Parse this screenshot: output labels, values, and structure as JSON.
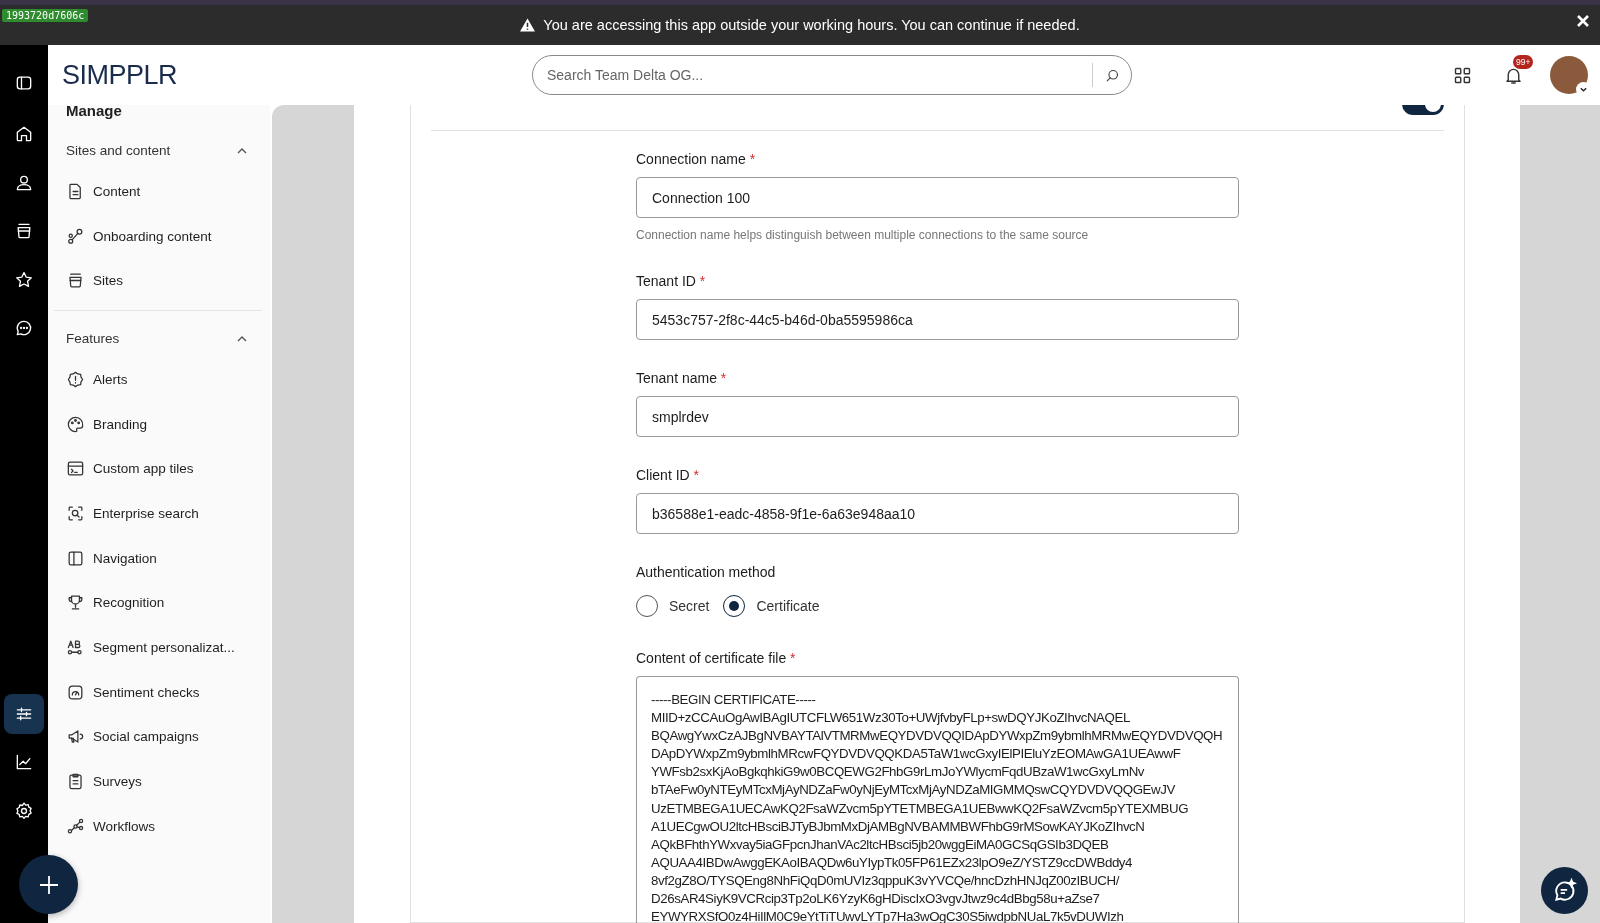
{
  "env_tag": "1993720d7606c",
  "banner": {
    "message": "You are accessing this app outside your working hours. You can continue if needed."
  },
  "header": {
    "logo": "SIMPPLR",
    "search": {
      "placeholder": "Search Team Delta OG..."
    },
    "notification_badge": "99+"
  },
  "rail": {
    "top_items": [
      {
        "kind": "home",
        "selected": false
      },
      {
        "kind": "person",
        "selected": false
      },
      {
        "kind": "sites",
        "selected": false
      },
      {
        "kind": "star",
        "selected": false
      },
      {
        "kind": "chat",
        "selected": false
      }
    ],
    "bottom_items": [
      {
        "kind": "sliders",
        "selected": true
      },
      {
        "kind": "chart",
        "selected": false
      },
      {
        "kind": "gear",
        "selected": false
      }
    ]
  },
  "sidebar": {
    "title": "Manage",
    "sections": [
      {
        "title": "Sites and content",
        "expanded": true,
        "items": [
          {
            "kind": "content",
            "label": "Content"
          },
          {
            "kind": "onboarding",
            "label": "Onboarding content"
          },
          {
            "kind": "sites",
            "label": "Sites"
          }
        ]
      },
      {
        "title": "Features",
        "expanded": true,
        "items": [
          {
            "kind": "alert",
            "label": "Alerts"
          },
          {
            "kind": "palette",
            "label": "Branding"
          },
          {
            "kind": "tiles",
            "label": "Custom app tiles"
          },
          {
            "kind": "search",
            "label": "Enterprise search"
          },
          {
            "kind": "navigation",
            "label": "Navigation"
          },
          {
            "kind": "trophy",
            "label": "Recognition"
          },
          {
            "kind": "segment",
            "label": "Segment personalizat..."
          },
          {
            "kind": "gauge",
            "label": "Sentiment checks"
          },
          {
            "kind": "megaphone",
            "label": "Social campaigns"
          },
          {
            "kind": "clipboard",
            "label": "Surveys"
          },
          {
            "kind": "workflow",
            "label": "Workflows"
          }
        ]
      }
    ]
  },
  "card": {
    "show_in_results": {
      "on": true
    },
    "fields": [
      {
        "label": "Connection name",
        "required_mark": "*",
        "value": "Connection 100",
        "hint": "Connection name helps distinguish between multiple connections to the same source"
      },
      {
        "label": "Tenant ID",
        "required_mark": "*",
        "value": "5453c757-2f8c-44c5-b46d-0ba5595986ca"
      },
      {
        "label": "Tenant name",
        "required_mark": "*",
        "value": "smplrdev"
      },
      {
        "label": "Client ID",
        "required_mark": "*",
        "value": "b36588e1-eadc-4858-9f1e-6a63e948aa10"
      }
    ],
    "auth": {
      "label": "Authentication method",
      "options": [
        {
          "label": "Secret",
          "selected": false
        },
        {
          "label": "Certificate",
          "selected": true
        }
      ]
    },
    "certificate": {
      "label": "Content of certificate file",
      "required_mark": "*",
      "value": "-----BEGIN CERTIFICATE-----\nMIID+zCCAuOgAwIBAgIUTCFLW651Wz30To+UWjfvbyFLp+swDQYJKoZIhvcNAQEL\nBQAwgYwxCzAJBgNVBAYTAlVTMRMwEQYDVDVQQIDApDYWxpZm9ybmlhMRMwEQYDVDVQQH\nDApDYWxpZm9ybmlhMRcwFQYDVDVQQKDA5TaW1wcGxyIElPIEluYzEOMAwGA1UEAwwF\nYWFsb2sxKjAoBgkqhkiG9w0BCQEWG2FhbG9rLmJoYWlycmFqdUBzaW1wcGxyLmNv\nbTAeFw0yNTEyMTcxMjAyNDZaFw0yNjEyMTcxMjAyNDZaMIGMMQswCQYDVDVQQGEwJV\nUzETMBEGA1UECAwKQ2FsaWZvcm5pYTETMBEGA1UEBwwKQ2FsaWZvcm5pYTEXMBUG\nA1UECgwOU2ltcHBsciBJTyBJbmMxDjAMBgNVBAMMBWFhbG9rMSowKAYJKoZIhvcN\nAQkBFhthYWxvay5iaGFpcnJhanVAc2ltcHBsci5jb20wggEiMA0GCSqGSIb3DQEB\nAQUAA4IBDwAwggEKAoIBAQDw6uYIypTk05FP61EZx23lpO9eZ/YSTZ9ccDWBddy4\n8vf2gZ8O/TYSQEng8NhFiQqD0mUVIz3qppuK3vYVCQe/hncDzhHNJqZ00zIBUCH/\nD26sAR4SiyK9VCRcip3Tp2oLK6YzyK6gHDiscIxO3vgvJtwz9c4dBbg58u+aZse7\nEYWYRXSfO0z4HiIlM0C9eYtTiTUwvLYTp7Ha3wOgC30S5iwdpbNUaL7k5vDUWIzh"
    }
  }
}
